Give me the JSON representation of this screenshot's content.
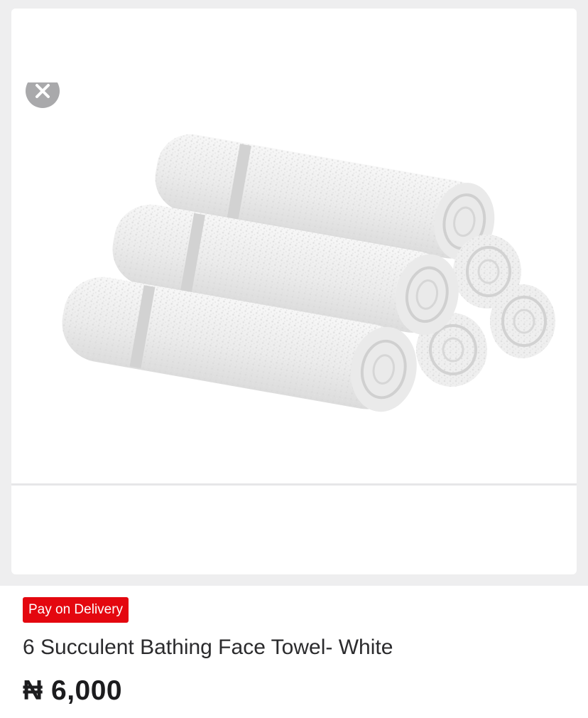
{
  "product": {
    "image_icon": "towel-stack-image",
    "close_icon": "close-icon",
    "badge_label": "Pay on Delivery",
    "badge_color": "#e4070f",
    "title": "6 Succulent Bathing Face Towel- White",
    "price": "₦ 6,000"
  }
}
